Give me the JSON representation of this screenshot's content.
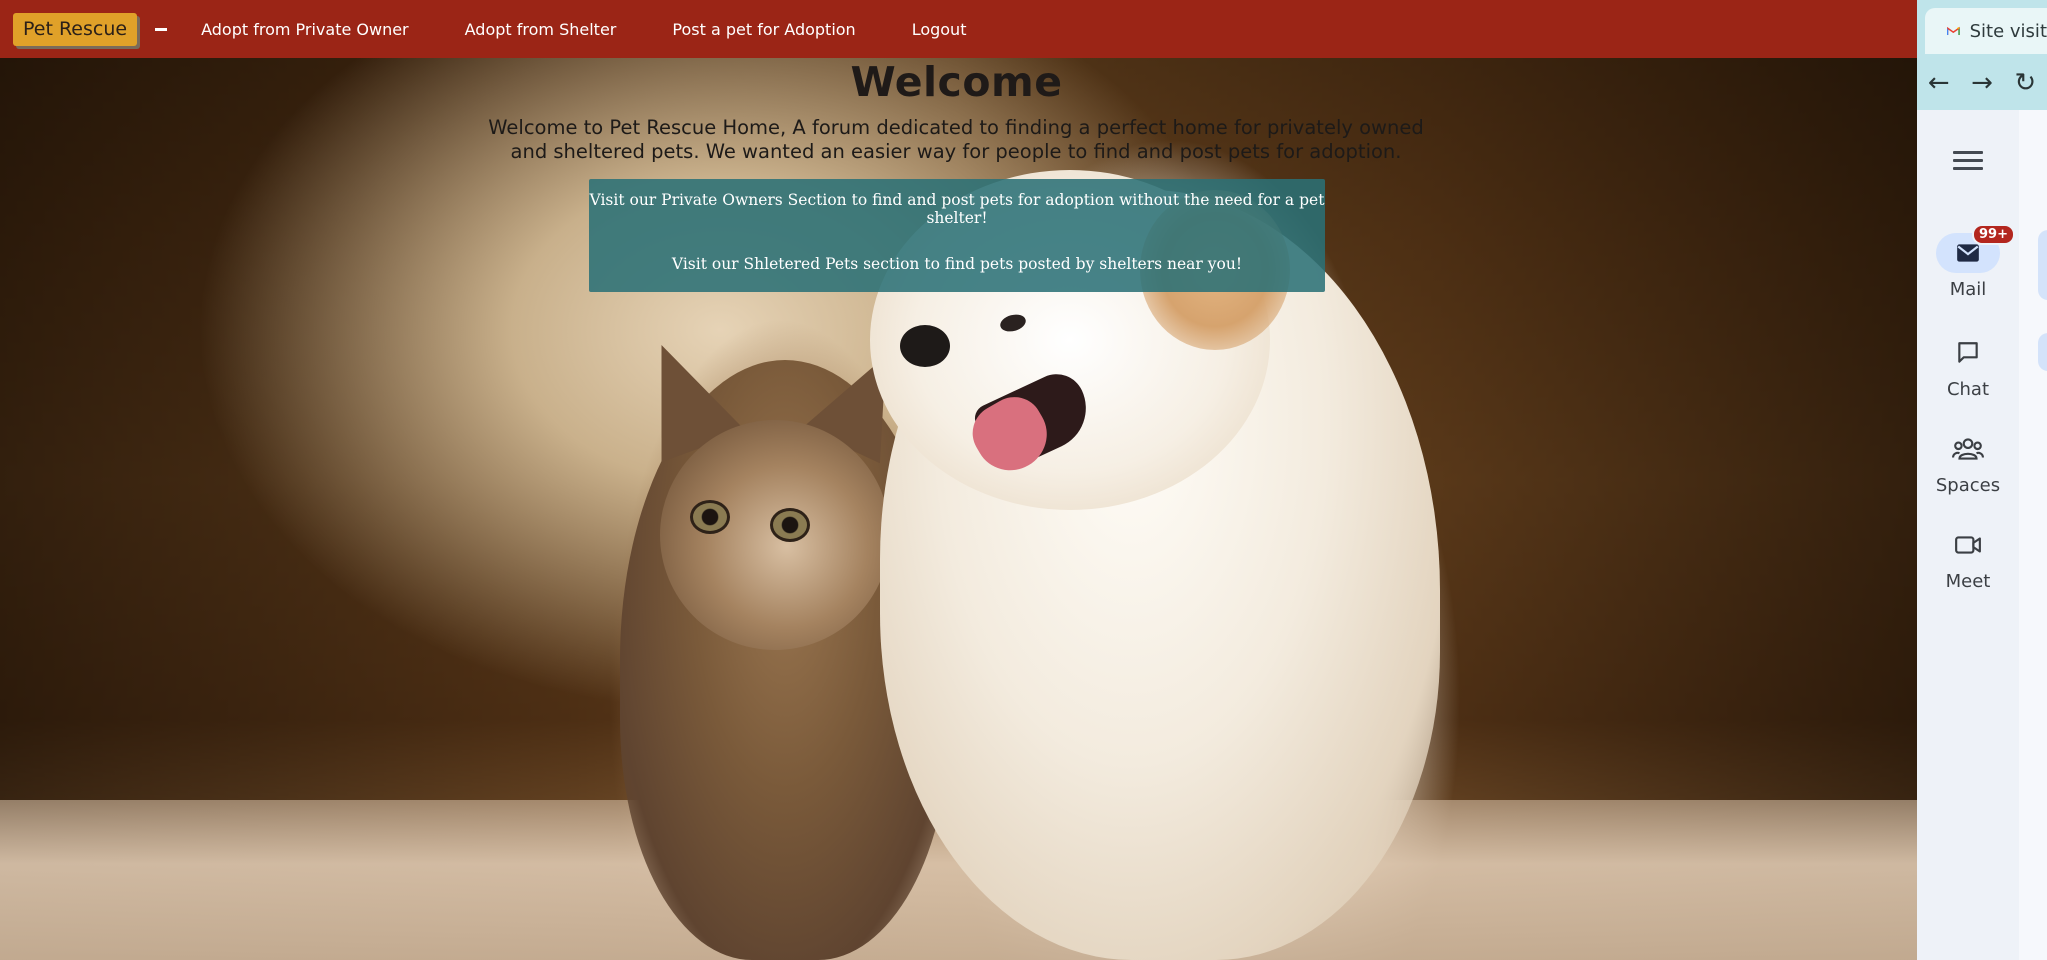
{
  "navbar": {
    "brand": "Pet Rescue",
    "links": [
      "Adopt from Private Owner",
      "Adopt from Shelter",
      "Post a pet for Adoption",
      "Logout"
    ],
    "background_color": "#9b2516",
    "brand_color": "#e0a129"
  },
  "hero": {
    "title": "Welcome",
    "intro": "Welcome to Pet Rescue Home, A forum dedicated to finding a perfect home for privately owned and sheltered pets. We wanted an easier way for people to find and post pets for adoption.",
    "info_line_1": "Visit our Private Owners Section to find and post pets for adoption without the need for a pet shelter!",
    "info_line_2": "Visit our Shletered Pets section to find pets posted by shelters near you!",
    "info_box_color": "#2a7076"
  },
  "side_panel": {
    "tab_title": "Site visit",
    "rail": [
      {
        "label": "Mail",
        "icon": "mail-icon",
        "badge": "99+"
      },
      {
        "label": "Chat",
        "icon": "chat-icon"
      },
      {
        "label": "Spaces",
        "icon": "spaces-icon"
      },
      {
        "label": "Meet",
        "icon": "meet-icon"
      }
    ]
  }
}
